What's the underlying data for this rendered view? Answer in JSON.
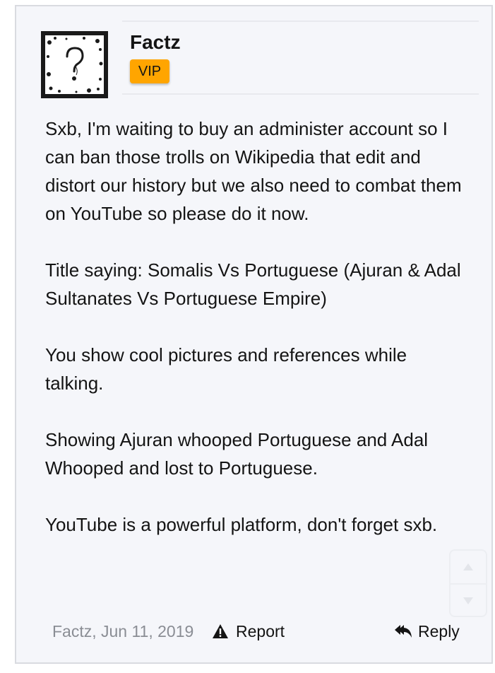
{
  "post": {
    "author": "Factz",
    "badge": "VIP",
    "paragraphs": [
      "Sxb, I'm waiting to buy an administer account so I can ban those trolls on Wikipedia that edit and distort our history but we also need to combat them on YouTube so please do it now.",
      "Title saying: Somalis Vs Portuguese (Ajuran & Adal Sultanates Vs Portuguese Empire)",
      "You show cool pictures and references while talking.",
      "Showing Ajuran whooped Portuguese and Adal Whooped and lost to Portuguese.",
      "YouTube is a powerful platform, don't forget sxb."
    ],
    "meta": "Factz, Jun 11, 2019",
    "report_label": "Report",
    "reply_label": "Reply"
  },
  "icons": {
    "avatar": "question-mark-avatar-icon",
    "report": "warning-triangle-icon",
    "reply": "reply-arrow-icon",
    "scroll_up": "triangle-up-icon",
    "scroll_down": "triangle-down-icon"
  },
  "colors": {
    "badge": "#ffa500",
    "background": "#f5f6fa",
    "meta_text": "#8a8d94"
  }
}
